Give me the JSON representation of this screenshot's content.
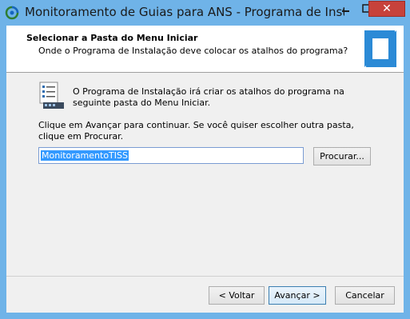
{
  "window": {
    "title": "Monitoramento de Guias para ANS - Programa de Instal",
    "minimize_label": "",
    "maximize_label": "",
    "close_label": "✕"
  },
  "header": {
    "title": "Selecionar a Pasta do Menu Iniciar",
    "subtitle": "Onde o Programa de Instalação deve colocar os atalhos do programa?"
  },
  "content": {
    "description": "O Programa de Instalação irá criar os atalhos do programa na seguinte pasta do Menu Iniciar.",
    "instruction": "Clique em Avançar para continuar. Se você quiser escolher outra pasta, clique em Procurar.",
    "folder_value": "MonitoramentoTISS",
    "browse_label": "Procurar..."
  },
  "footer": {
    "back_label": "< Voltar",
    "next_label": "Avançar >",
    "cancel_label": "Cancelar"
  },
  "colors": {
    "titlebar": "#6fb3e8",
    "close_button": "#c7423b",
    "selection": "#3399ff",
    "logo": "#2b8ad6"
  }
}
